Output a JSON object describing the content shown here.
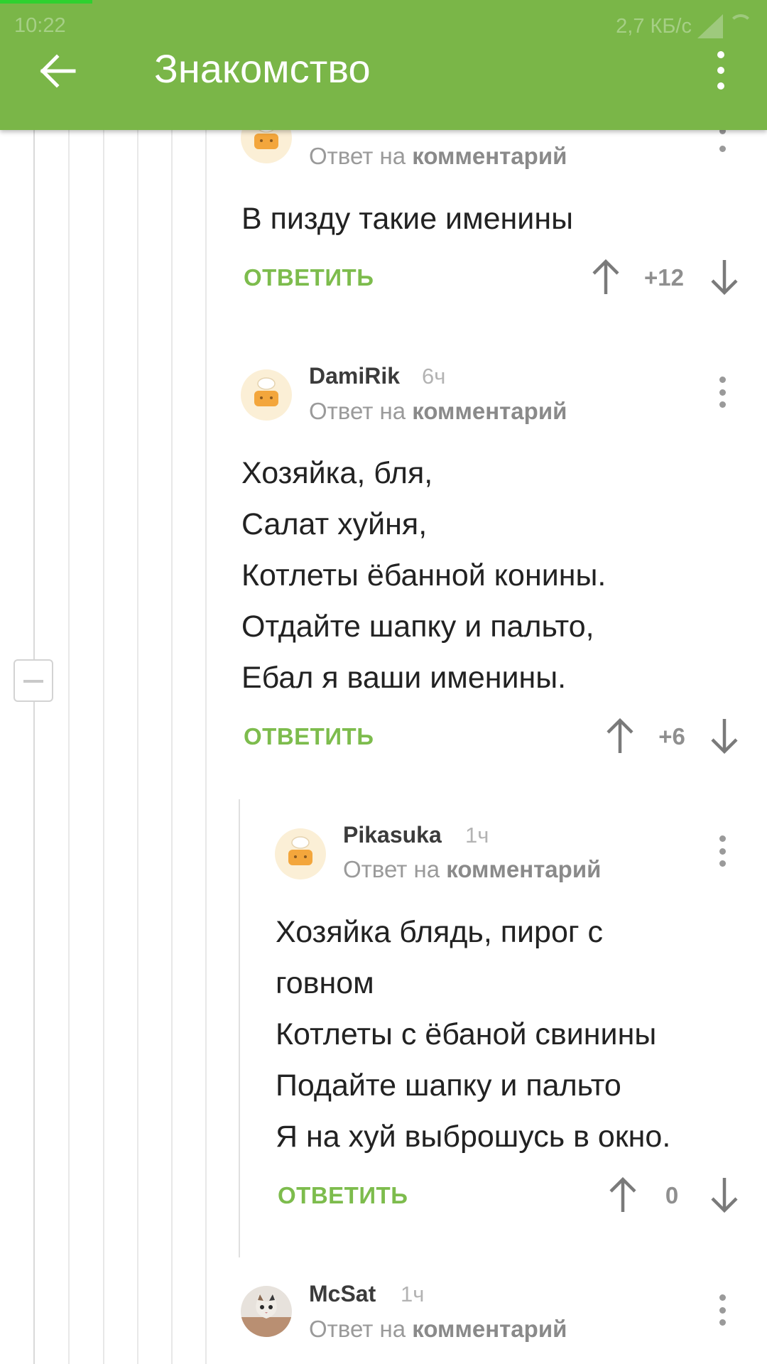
{
  "status_bar": {
    "time": "10:22",
    "speed": "2,7 КБ/с"
  },
  "header": {
    "title": "Знакомство"
  },
  "colors": {
    "accent": "#7ab648",
    "reply": "#7dbc4d"
  },
  "comments": [
    {
      "author": "",
      "time": "",
      "reply_prefix": "Ответ на",
      "reply_target": "комментарий",
      "text": "В пизду такие именины",
      "reply_label": "ОТВЕТИТЬ",
      "score": "+12"
    },
    {
      "author": "DamiRik",
      "time": "6ч",
      "reply_prefix": "Ответ на",
      "reply_target": "комментарий",
      "lines": [
        "Хозяйка, бля,",
        "Салат хуйня,",
        "Котлеты ёбанной конины.",
        "Отдайте шапку и пальто,",
        "Ебал я ваши именины."
      ],
      "reply_label": "ОТВЕТИТЬ",
      "score": "+6"
    },
    {
      "author": "Pikasuka",
      "time": "1ч",
      "reply_prefix": "Ответ на",
      "reply_target": "комментарий",
      "lines": [
        "Хозяйка блядь, пирог с",
        "говном",
        "Котлеты с ёбаной свинины",
        "Подайте шапку и пальто",
        "Я на хуй выброшусь в окно."
      ],
      "reply_label": "ОТВЕТИТЬ",
      "score": "0"
    },
    {
      "author": "McSat",
      "time": "1ч",
      "reply_prefix": "Ответ на",
      "reply_target": "комментарий"
    }
  ]
}
